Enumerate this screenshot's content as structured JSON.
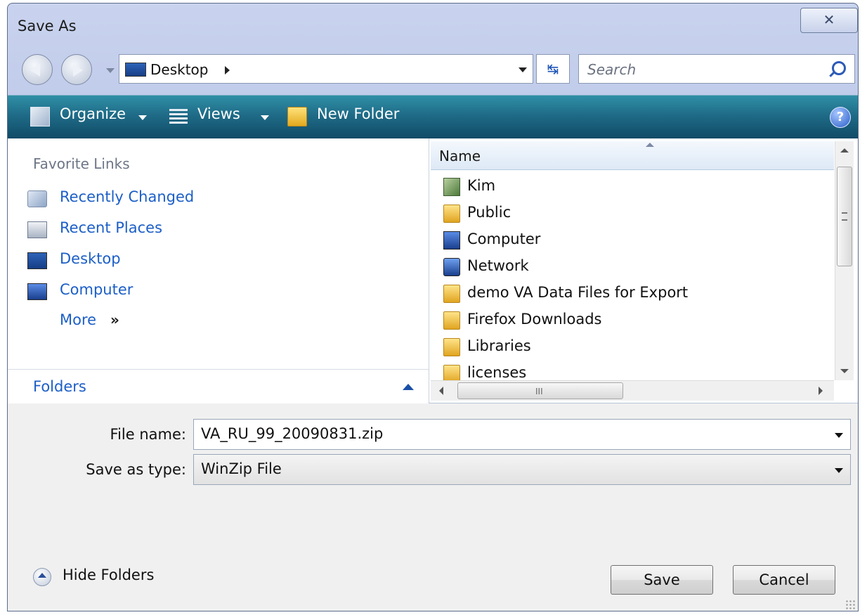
{
  "window": {
    "title": "Save As",
    "close_glyph": "✕"
  },
  "nav": {
    "address": {
      "location": "Desktop"
    },
    "search_placeholder": "Search",
    "refresh_glyph": "↹"
  },
  "toolbar": {
    "organize": "Organize",
    "views": "Views",
    "new_folder": "New Folder",
    "help_glyph": "?"
  },
  "favorites": {
    "header": "Favorite Links",
    "items": [
      {
        "label": "Recently Changed",
        "icon": "recently-changed-icon"
      },
      {
        "label": "Recent Places",
        "icon": "recent-places-icon"
      },
      {
        "label": "Desktop",
        "icon": "desktop-icon"
      },
      {
        "label": "Computer",
        "icon": "computer-icon"
      }
    ],
    "more": "More",
    "more_chevron": "»",
    "folders": "Folders"
  },
  "files": {
    "column_name": "Name",
    "items": [
      {
        "label": "Kim",
        "icon": "user-folder-icon"
      },
      {
        "label": "Public",
        "icon": "folder-icon"
      },
      {
        "label": "Computer",
        "icon": "computer-icon"
      },
      {
        "label": "Network",
        "icon": "network-icon"
      },
      {
        "label": "demo VA Data Files for Export",
        "icon": "folder-icon"
      },
      {
        "label": "Firefox Downloads",
        "icon": "folder-icon"
      },
      {
        "label": "Libraries",
        "icon": "folder-icon"
      },
      {
        "label": "licenses",
        "icon": "folder-icon"
      }
    ],
    "hscroll_grip": "III"
  },
  "form": {
    "file_name_label": "File name:",
    "file_name_value": "VA_RU_99_20090831.zip",
    "save_type_label": "Save as type:",
    "save_type_value": "WinZip File"
  },
  "footer": {
    "hide_folders": "Hide Folders",
    "save": "Save",
    "cancel": "Cancel"
  }
}
